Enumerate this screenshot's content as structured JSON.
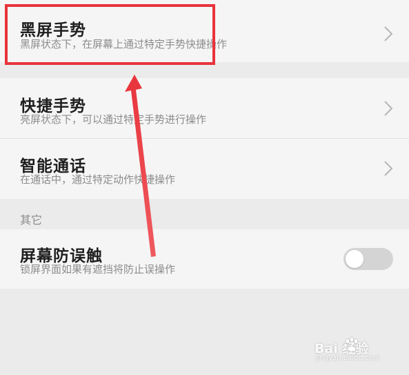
{
  "gestures_group": {
    "black_screen": {
      "title": "黑屏手势",
      "subtitle": "黑屏状态下，在屏幕上通过特定手势快捷操作"
    }
  },
  "shortcuts_group": {
    "quick_gesture": {
      "title": "快捷手势",
      "subtitle": "亮屏状态下，可以通过特定手势进行操作"
    },
    "smart_call": {
      "title": "智能通话",
      "subtitle": "在通话中，通过特定动作快捷操作"
    }
  },
  "other_section": {
    "label": "其它",
    "accidental_touch": {
      "title": "屏幕防误触",
      "subtitle": "锁屏界面如果有遮挡将防止误操作",
      "toggle_on": false
    }
  },
  "icons": {
    "chevron": "chevron-right-icon",
    "annotation": "red-arrow-annotation"
  },
  "colors": {
    "annotation_red": "#e8343c",
    "row_background": "#f5f5f5",
    "page_background": "#ebebeb",
    "toggle_off": "#d4d4d4"
  },
  "watermark": {
    "brand": "Bai  经验",
    "url": "jingyan.baidu.com"
  }
}
